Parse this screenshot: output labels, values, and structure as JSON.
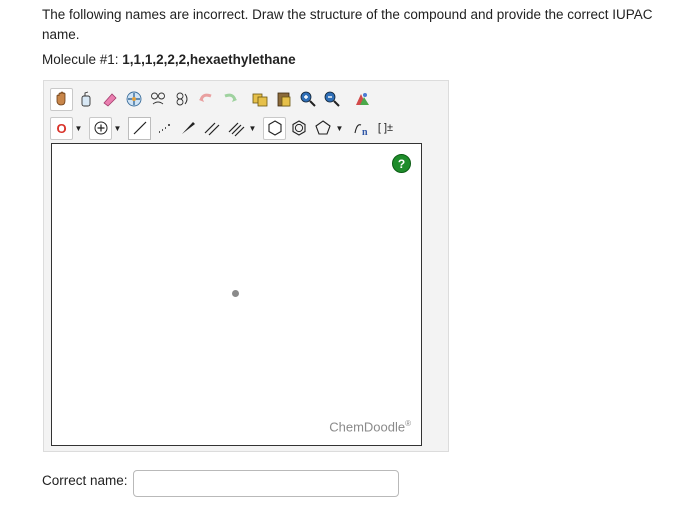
{
  "question": {
    "instructions": "The following names are incorrect. Draw the structure of the compound and provide the correct IUPAC name.",
    "molecule_label": "Molecule #1: ",
    "molecule_name": "1,1,1,2,2,2,hexaethylethane"
  },
  "editor": {
    "element_label": "O",
    "templates_label": "[ ]±",
    "help_label": "?",
    "watermark": "ChemDoodle",
    "watermark_mark": "®"
  },
  "answer": {
    "label": "Correct name:",
    "value": "",
    "placeholder": ""
  },
  "colors": {
    "help_green": "#1e8c2a",
    "element_red": "#d9342b",
    "canvas_border": "#333333"
  }
}
